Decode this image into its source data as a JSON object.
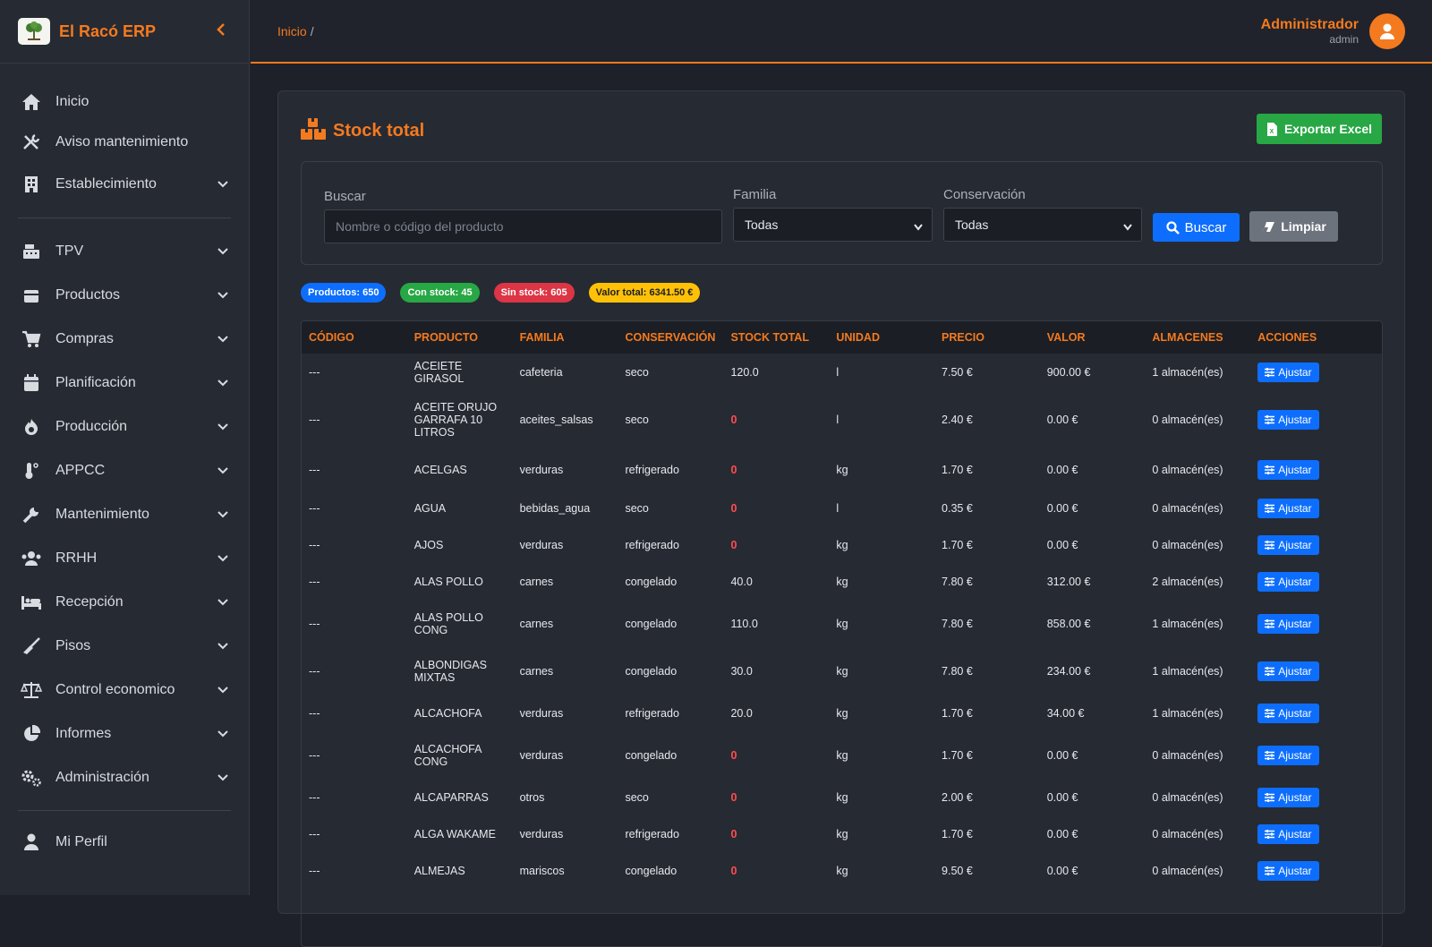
{
  "app": {
    "name": "El Racó ERP"
  },
  "sidebar": {
    "items_top": [
      {
        "label": "Inicio",
        "icon": "home-icon"
      },
      {
        "label": "Aviso mantenimiento",
        "icon": "tools-icon"
      },
      {
        "label": "Establecimiento",
        "icon": "building-icon"
      }
    ],
    "items_main": [
      {
        "label": "TPV",
        "icon": "cash-register-icon"
      },
      {
        "label": "Productos",
        "icon": "box-icon"
      },
      {
        "label": "Compras",
        "icon": "cart-icon"
      },
      {
        "label": "Planificación",
        "icon": "calendar-icon"
      },
      {
        "label": "Producción",
        "icon": "fire-icon"
      },
      {
        "label": "APPCC",
        "icon": "thermometer-icon"
      },
      {
        "label": "Mantenimiento",
        "icon": "wrench-icon"
      },
      {
        "label": "RRHH",
        "icon": "users-icon"
      },
      {
        "label": "Recepción",
        "icon": "bed-icon"
      },
      {
        "label": "Pisos",
        "icon": "broom-icon"
      },
      {
        "label": "Control economico",
        "icon": "scale-icon"
      },
      {
        "label": "Informes",
        "icon": "pie-chart-icon"
      },
      {
        "label": "Administración",
        "icon": "gears-icon"
      }
    ],
    "items_bottom": [
      {
        "label": "Mi Perfil",
        "icon": "user-icon"
      }
    ]
  },
  "topbar": {
    "breadcrumb": "Inicio",
    "breadcrumb_sep": "/",
    "user_name": "Administrador",
    "user_role": "admin"
  },
  "page": {
    "title": "Stock total",
    "export_label": "Exportar Excel"
  },
  "filters": {
    "search_label": "Buscar",
    "search_placeholder": "Nombre o código del producto",
    "familia_label": "Familia",
    "familia_value": "Todas",
    "conservacion_label": "Conservación",
    "conservacion_value": "Todas",
    "search_button": "Buscar",
    "clear_button": "Limpiar"
  },
  "badges": [
    {
      "text": "Productos: 650",
      "color": "#0d6efd",
      "fg": "#ffffff"
    },
    {
      "text": "Con stock: 45",
      "color": "#28a745",
      "fg": "#ffffff"
    },
    {
      "text": "Sin stock: 605",
      "color": "#dc3545",
      "fg": "#ffffff"
    },
    {
      "text": "Valor total: 6341.50 €",
      "color": "#ffc107",
      "fg": "#1b1e24"
    }
  ],
  "table": {
    "headers": [
      "CÓDIGO",
      "PRODUCTO",
      "FAMILIA",
      "CONSERVACIÓN",
      "STOCK TOTAL",
      "UNIDAD",
      "PRECIO",
      "VALOR",
      "ALMACENES",
      "ACCIONES"
    ],
    "action_label": "Ajustar",
    "rows": [
      {
        "codigo": "---",
        "producto": "ACEIETE GIRASOL",
        "familia": "cafeteria",
        "conservacion": "seco",
        "stock": "120.0",
        "unidad": "l",
        "precio": "7.50 €",
        "valor": "900.00 €",
        "almacenes": "1 almacén(es)"
      },
      {
        "codigo": "---",
        "producto": "ACEITE ORUJO GARRAFA 10 LITROS",
        "familia": "aceites_salsas",
        "conservacion": "seco",
        "stock": "0",
        "unidad": "l",
        "precio": "2.40 €",
        "valor": "0.00 €",
        "almacenes": "0 almacén(es)"
      },
      {
        "codigo": "---",
        "producto": "ACELGAS",
        "familia": "verduras",
        "conservacion": "refrigerado",
        "stock": "0",
        "unidad": "kg",
        "precio": "1.70 €",
        "valor": "0.00 €",
        "almacenes": "0 almacén(es)"
      },
      {
        "codigo": "---",
        "producto": "AGUA",
        "familia": "bebidas_agua",
        "conservacion": "seco",
        "stock": "0",
        "unidad": "l",
        "precio": "0.35 €",
        "valor": "0.00 €",
        "almacenes": "0 almacén(es)"
      },
      {
        "codigo": "---",
        "producto": "AJOS",
        "familia": "verduras",
        "conservacion": "refrigerado",
        "stock": "0",
        "unidad": "kg",
        "precio": "1.70 €",
        "valor": "0.00 €",
        "almacenes": "0 almacén(es)"
      },
      {
        "codigo": "---",
        "producto": "ALAS POLLO",
        "familia": "carnes",
        "conservacion": "congelado",
        "stock": "40.0",
        "unidad": "kg",
        "precio": "7.80 €",
        "valor": "312.00 €",
        "almacenes": "2 almacén(es)"
      },
      {
        "codigo": "---",
        "producto": "ALAS POLLO CONG",
        "familia": "carnes",
        "conservacion": "congelado",
        "stock": "110.0",
        "unidad": "kg",
        "precio": "7.80 €",
        "valor": "858.00 €",
        "almacenes": "1 almacén(es)"
      },
      {
        "codigo": "---",
        "producto": "ALBONDIGAS MIXTAS",
        "familia": "carnes",
        "conservacion": "congelado",
        "stock": "30.0",
        "unidad": "kg",
        "precio": "7.80 €",
        "valor": "234.00 €",
        "almacenes": "1 almacén(es)"
      },
      {
        "codigo": "---",
        "producto": "ALCACHOFA",
        "familia": "verduras",
        "conservacion": "refrigerado",
        "stock": "20.0",
        "unidad": "kg",
        "precio": "1.70 €",
        "valor": "34.00 €",
        "almacenes": "1 almacén(es)"
      },
      {
        "codigo": "---",
        "producto": "ALCACHOFA CONG",
        "familia": "verduras",
        "conservacion": "congelado",
        "stock": "0",
        "unidad": "kg",
        "precio": "1.70 €",
        "valor": "0.00 €",
        "almacenes": "0 almacén(es)"
      },
      {
        "codigo": "---",
        "producto": "ALCAPARRAS",
        "familia": "otros",
        "conservacion": "seco",
        "stock": "0",
        "unidad": "kg",
        "precio": "2.00 €",
        "valor": "0.00 €",
        "almacenes": "0 almacén(es)"
      },
      {
        "codigo": "---",
        "producto": "ALGA WAKAME",
        "familia": "verduras",
        "conservacion": "refrigerado",
        "stock": "0",
        "unidad": "kg",
        "precio": "1.70 €",
        "valor": "0.00 €",
        "almacenes": "0 almacén(es)"
      },
      {
        "codigo": "---",
        "producto": "ALMEJAS",
        "familia": "mariscos",
        "conservacion": "congelado",
        "stock": "0",
        "unidad": "kg",
        "precio": "9.50 €",
        "valor": "0.00 €",
        "almacenes": "0 almacén(es)"
      }
    ]
  }
}
